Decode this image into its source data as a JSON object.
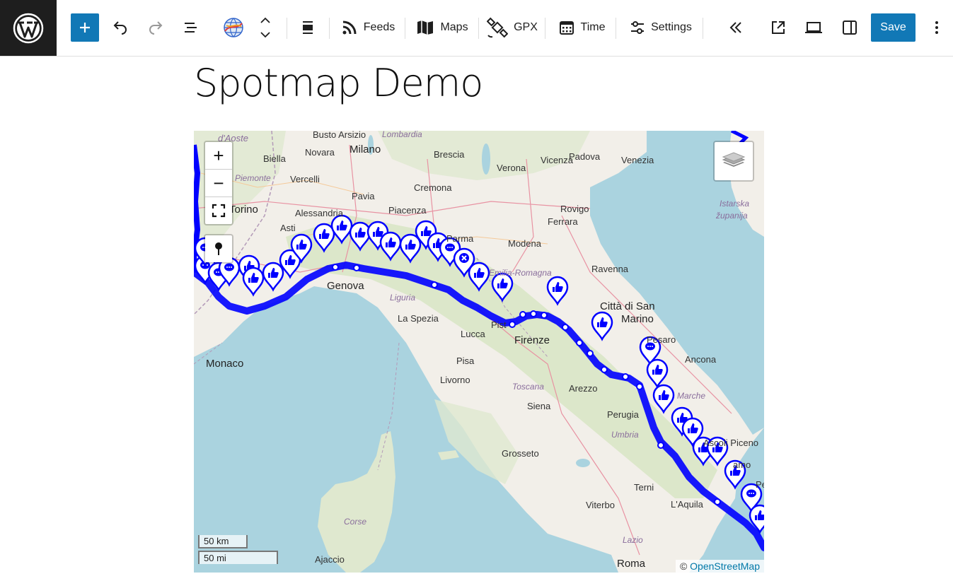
{
  "toolbar": {
    "feeds_label": "Feeds",
    "maps_label": "Maps",
    "gpx_label": "GPX",
    "time_label": "Time",
    "settings_label": "Settings",
    "save_label": "Save",
    "accent": "#1178b6"
  },
  "page": {
    "title": "Spotmap Demo"
  },
  "map": {
    "zoom_in": "+",
    "zoom_out": "−",
    "scale_km": "50 km",
    "scale_mi": "50 mi",
    "attribution_prefix": "©",
    "attribution_link": "OpenStreetMap",
    "track_color": "#0000ff",
    "cities": {
      "aoste": "d'Aoste",
      "busto": "Busto Arsizio",
      "lombardia": "Lombardia",
      "vicenza": "Vicenza",
      "biella": "Biella",
      "milano": "Milano",
      "novara": "Novara",
      "brescia": "Brescia",
      "verona": "Verona",
      "padova": "Padova",
      "venezia": "Venezia",
      "piemonte": "Piemonte",
      "vercelli": "Vercelli",
      "cremona": "Cremona",
      "pavia": "Pavia",
      "torino": "Torino",
      "alessandria": "Alessandria",
      "piacenza": "Piacenza",
      "rovigo": "Rovigo",
      "istarska": "Istarska",
      "zupanija": "županija",
      "asti": "Asti",
      "ferrara": "Ferrara",
      "parma": "Parma",
      "modena": "Modena",
      "emilia": "Emilia-Romagna",
      "ravenna": "Ravenna",
      "genova": "Genova",
      "liguria": "Liguria",
      "citta": "Città di San",
      "marino": "Marino",
      "laspezia": "La Spezia",
      "pistoia": "Pist",
      "pesaro": "Pesaro",
      "lucca": "Lucca",
      "firenze": "Firenze",
      "ancona": "Ancona",
      "monaco": "Monaco",
      "pisa": "Pisa",
      "livorno": "Livorno",
      "toscana": "Toscana",
      "arezzo": "Arezzo",
      "marche": "Marche",
      "siena": "Siena",
      "perugia": "Perugia",
      "umbria": "Umbria",
      "grosseto": "Grosseto",
      "ascoli": "Ascoli Piceno",
      "teramo": "amo",
      "terni": "Terni",
      "corse": "Corse",
      "viterbo": "Viterbo",
      "laquila": "L'Aquila",
      "pe": "Pe",
      "lazio": "Lazio",
      "ajaccio": "Ajaccio",
      "roma": "Roma"
    }
  }
}
